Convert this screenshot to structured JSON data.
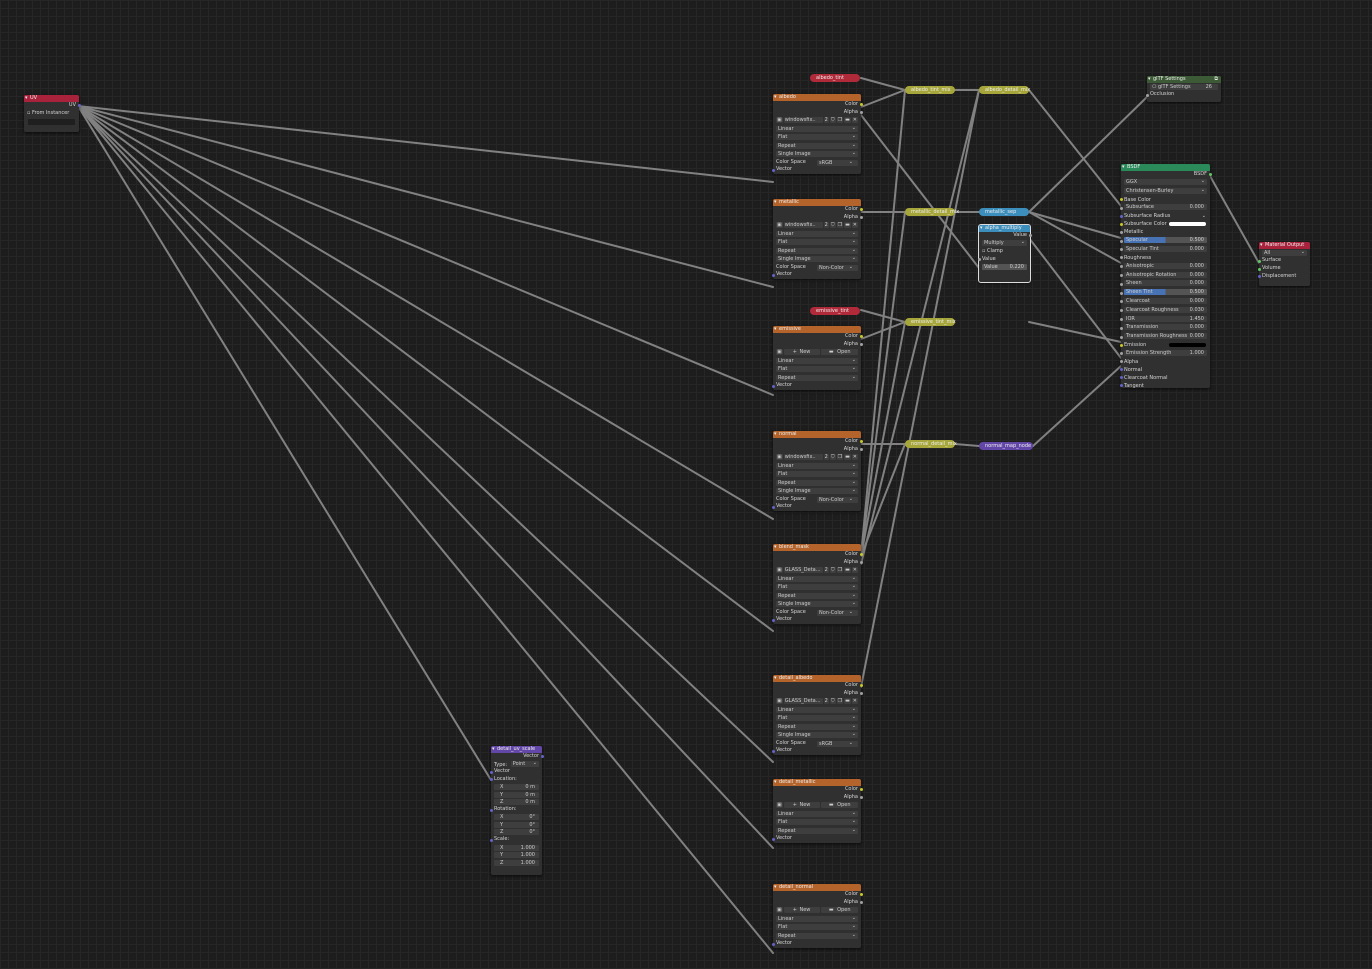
{
  "uv_node": {
    "title": "UV",
    "out": "UV",
    "from_instancer": "From Instancer"
  },
  "textures": [
    {
      "title": "albedo",
      "color": "Color",
      "alpha": "Alpha",
      "image": "windowsfix..",
      "users": "2",
      "interp": "Linear",
      "proj": "Flat",
      "ext": "Repeat",
      "src": "Single Image",
      "cs_label": "Color Space",
      "cs": "sRGB",
      "vector": "Vector"
    },
    {
      "title": "metallic",
      "color": "Color",
      "alpha": "Alpha",
      "image": "windowsfix..",
      "users": "2",
      "interp": "Linear",
      "proj": "Flat",
      "ext": "Repeat",
      "src": "Single Image",
      "cs_label": "Color Space",
      "cs": "Non-Color",
      "vector": "Vector"
    },
    {
      "title": "emissive",
      "color": "Color",
      "alpha": "Alpha",
      "new": "New",
      "open": "Open",
      "interp": "Linear",
      "proj": "Flat",
      "ext": "Repeat",
      "vector": "Vector"
    },
    {
      "title": "normal",
      "color": "Color",
      "alpha": "Alpha",
      "image": "windowsfix..",
      "users": "2",
      "interp": "Linear",
      "proj": "Flat",
      "ext": "Repeat",
      "src": "Single Image",
      "cs_label": "Color Space",
      "cs": "Non-Color",
      "vector": "Vector"
    },
    {
      "title": "blend_mask",
      "color": "Color",
      "alpha": "Alpha",
      "image": "GLASS_Deta...",
      "users": "2",
      "interp": "Linear",
      "proj": "Flat",
      "ext": "Repeat",
      "src": "Single Image",
      "cs_label": "Color Space",
      "cs": "Non-Color",
      "vector": "Vector"
    },
    {
      "title": "detail_albedo",
      "color": "Color",
      "alpha": "Alpha",
      "image": "GLASS_Deta...",
      "users": "2",
      "interp": "Linear",
      "proj": "Flat",
      "ext": "Repeat",
      "src": "Single Image",
      "cs_label": "Color Space",
      "cs": "sRGB",
      "vector": "Vector"
    },
    {
      "title": "detail_metallic",
      "color": "Color",
      "alpha": "Alpha",
      "new": "New",
      "open": "Open",
      "interp": "Linear",
      "proj": "Flat",
      "ext": "Repeat",
      "vector": "Vector"
    },
    {
      "title": "detail_normal",
      "color": "Color",
      "alpha": "Alpha",
      "new": "New",
      "open": "Open",
      "interp": "Linear",
      "proj": "Flat",
      "ext": "Repeat",
      "vector": "Vector"
    }
  ],
  "reroutes": {
    "albedo_tint": "albedo_tint",
    "albedo_tint_mix": "albedo_tint_mix",
    "albedo_detail_mix": "albedo_detail_mix",
    "metallic_detail_mix": "metallic_detail_mix",
    "metallic_sep": "metallic_sep",
    "emissive_tint": "emissive_tint",
    "emissive_tint_mix": "emissive_tint_mix",
    "normal_detail_mix": "normal_detail_mix",
    "normal_map_node": "normal_map_node"
  },
  "alpha_multiply": {
    "title": "alpha_multiply",
    "value_out": "Value",
    "op": "Multiply",
    "clamp": "Clamp",
    "value_in": "Value",
    "value_label": "Value",
    "value": "0.220"
  },
  "mapping": {
    "title": "detail_uv_scale",
    "vector_out": "Vector",
    "type_label": "Type:",
    "type": "Point",
    "vector_in": "Vector",
    "location": "Location:",
    "rotation": "Rotation:",
    "scale": "Scale:",
    "x": "X",
    "y": "Y",
    "z": "Z",
    "loc_x": "0 m",
    "loc_y": "0 m",
    "loc_z": "0 m",
    "rot_x": "0°",
    "rot_y": "0°",
    "rot_z": "0°",
    "scl_x": "1.000",
    "scl_y": "1.000",
    "scl_z": "1.000"
  },
  "gltf": {
    "title": "glTF Settings",
    "group": "glTF Settings",
    "users": "26",
    "occlusion": "Occlusion"
  },
  "bsdf": {
    "title": "BSDF",
    "out": "BSDF",
    "dist": "GGX",
    "sss": "Christensen-Burley",
    "rows": [
      {
        "label": "Base Color"
      },
      {
        "label": "Subsurface",
        "value": "0.000"
      },
      {
        "label": "Subsurface Radius"
      },
      {
        "label": "Subsurface Color"
      },
      {
        "label": "Metallic"
      },
      {
        "label": "Specular",
        "value": "0.500"
      },
      {
        "label": "Specular Tint",
        "value": "0.000"
      },
      {
        "label": "Roughness"
      },
      {
        "label": "Anisotropic",
        "value": "0.000"
      },
      {
        "label": "Anisotropic Rotation",
        "value": "0.000"
      },
      {
        "label": "Sheen",
        "value": "0.000"
      },
      {
        "label": "Sheen Tint",
        "value": "0.500"
      },
      {
        "label": "Clearcoat",
        "value": "0.000"
      },
      {
        "label": "Clearcoat Roughness",
        "value": "0.030"
      },
      {
        "label": "IOR",
        "value": "1.450"
      },
      {
        "label": "Transmission",
        "value": "0.000"
      },
      {
        "label": "Transmission Roughness",
        "value": "0.000"
      },
      {
        "label": "Emission"
      },
      {
        "label": "Emission Strength",
        "value": "1.000"
      },
      {
        "label": "Alpha"
      },
      {
        "label": "Normal"
      },
      {
        "label": "Clearcoat Normal"
      },
      {
        "label": "Tangent"
      }
    ]
  },
  "output": {
    "title": "Material Output",
    "target": "All",
    "surface": "Surface",
    "volume": "Volume",
    "displacement": "Displacement"
  },
  "colors": {
    "tex_header": "#b4632a",
    "uv_header": "#a8223b",
    "vector_header": "#6347a8",
    "converter_header": "#3c8fbd",
    "shader_header": "#2b8a5a",
    "group_header": "#3c5a35",
    "output_header": "#a8223b",
    "mix_reroute": "#a6a63a",
    "tint_reroute": "#b02a3a"
  }
}
